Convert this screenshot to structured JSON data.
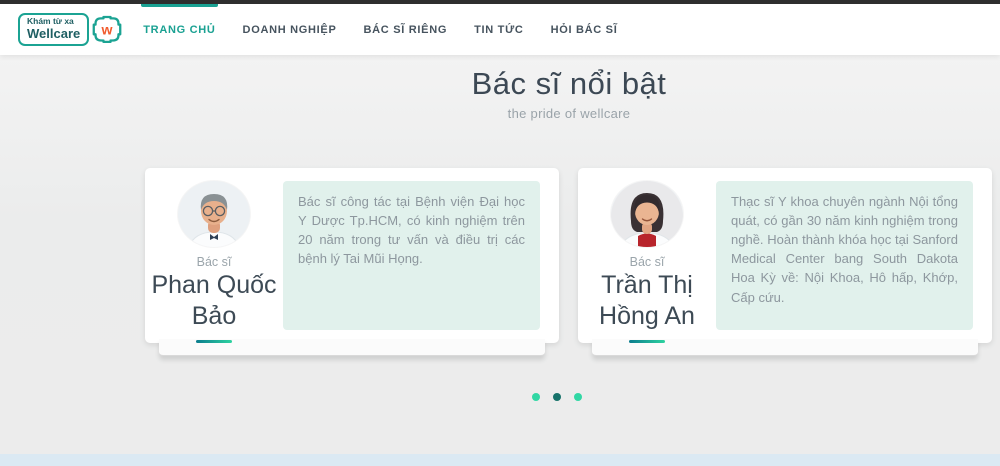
{
  "brand": {
    "tagline": "Khám từ xa",
    "name": "Wellcare",
    "mark_letter": "w"
  },
  "nav": {
    "items": [
      {
        "label": "TRANG CHỦ",
        "active": true
      },
      {
        "label": "DOANH NGHIỆP",
        "active": false
      },
      {
        "label": "BÁC SĨ RIÊNG",
        "active": false
      },
      {
        "label": "TIN TỨC",
        "active": false
      },
      {
        "label": "HỎI BÁC SĨ",
        "active": false
      }
    ]
  },
  "section": {
    "title": "Bác sĩ nổi bật",
    "subtitle": "the pride of wellcare"
  },
  "doctors": [
    {
      "role_label": "Bác sĩ",
      "name": "Phan Quốc Bảo",
      "bio": "Bác sĩ công tác tại Bệnh viện Đại học Y Dược Tp.HCM, có kinh nghiệm trên 20 năm trong tư vấn và điều trị các bệnh lý Tai Mũi Họng."
    },
    {
      "role_label": "Bác sĩ",
      "name": "Trần Thị Hồng An",
      "bio": "Thạc sĩ Y khoa chuyên ngành Nội tổng quát, có gần 30 năm kinh nghiệm trong nghề. Hoàn thành khóa học tại Sanford Medical Center bang South Dakota Hoa Kỳ về: Nội Khoa, Hô hấp, Khớp, Cấp cứu."
    }
  ],
  "carousel": {
    "dots": [
      {
        "active": false
      },
      {
        "active": true
      },
      {
        "active": false
      }
    ]
  },
  "colors": {
    "accent_teal": "#1aa192",
    "logo_teal": "#1ba393",
    "logo_orange": "#f15b2d",
    "mint_bg": "#e1f1ec",
    "dot_green": "#31d7a4",
    "dot_dark": "#17726a",
    "underline_start": "#0c7d8e",
    "underline_end": "#2ed3a0"
  }
}
